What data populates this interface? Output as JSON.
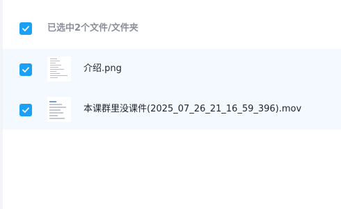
{
  "header": {
    "selection_summary": "已选中2个文件/文件夹",
    "checkbox_state": "checked"
  },
  "files": [
    {
      "name": "介绍.png",
      "checked": true,
      "thumbnail_icon": "image-thumbnail-icon"
    },
    {
      "name": "本课群里没课件(2025_07_26_21_16_59_396).mov",
      "checked": true,
      "thumbnail_icon": "video-thumbnail-icon"
    }
  ],
  "colors": {
    "accent": "#1aa1f5",
    "row_highlight": "#f3f9fe",
    "muted_text": "#8a8f99"
  }
}
